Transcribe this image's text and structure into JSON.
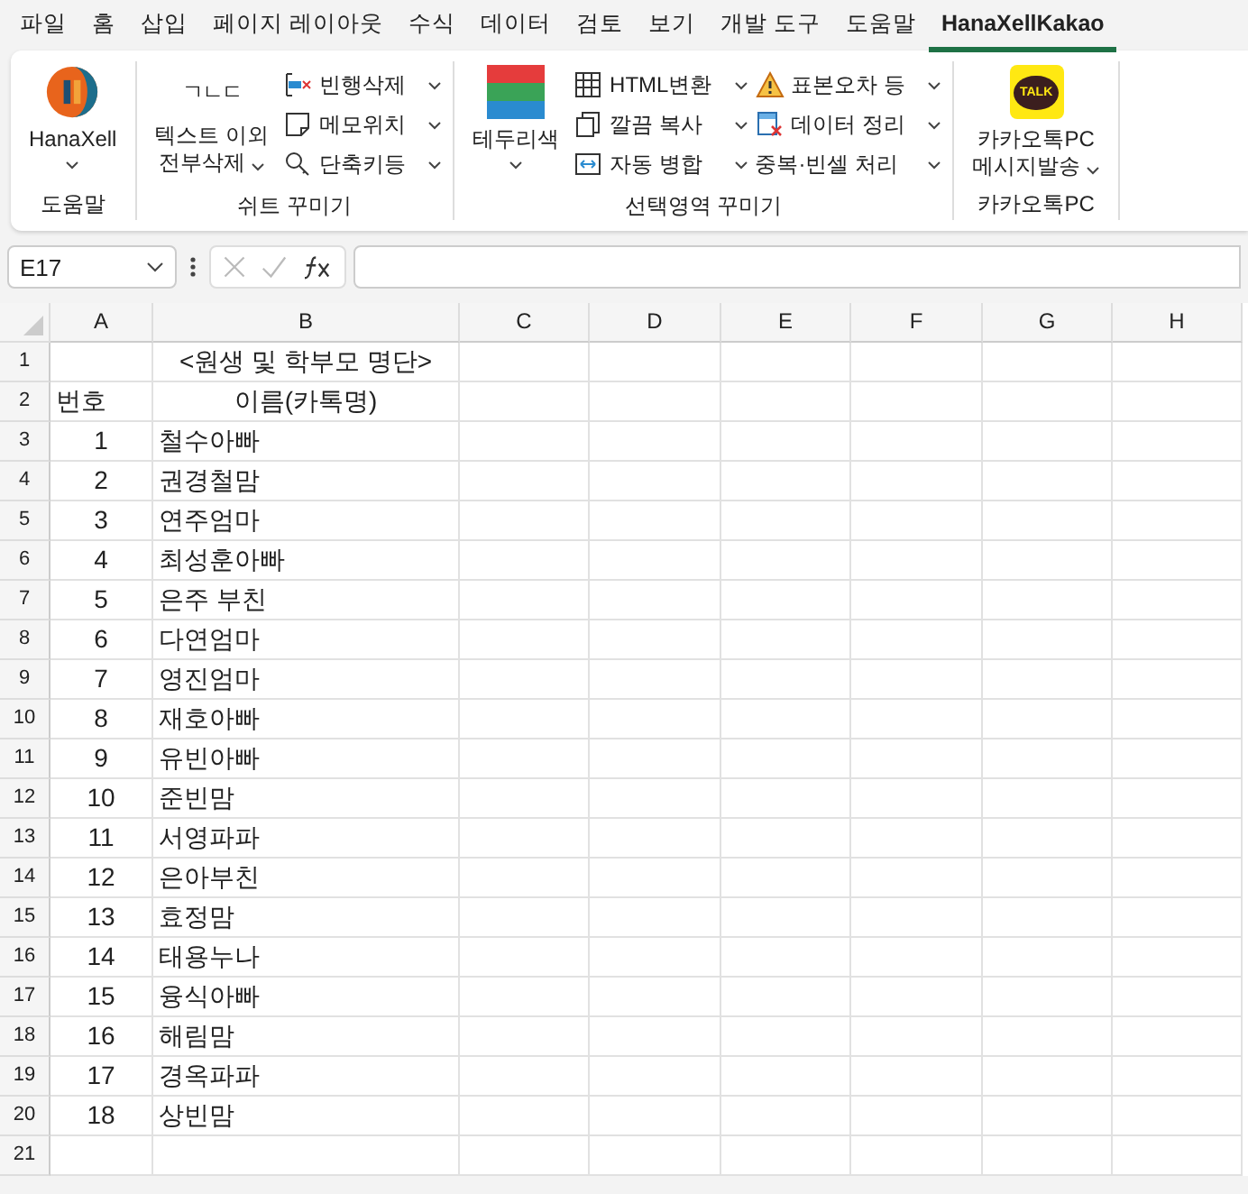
{
  "menu_tabs": [
    {
      "label": "파일",
      "selected": false
    },
    {
      "label": "홈",
      "selected": false
    },
    {
      "label": "삽입",
      "selected": false
    },
    {
      "label": "페이지 레이아웃",
      "selected": false
    },
    {
      "label": "수식",
      "selected": false
    },
    {
      "label": "데이터",
      "selected": false
    },
    {
      "label": "검토",
      "selected": false
    },
    {
      "label": "보기",
      "selected": false
    },
    {
      "label": "개발 도구",
      "selected": false
    },
    {
      "label": "도움말",
      "selected": false
    },
    {
      "label": "HanaXellKakao",
      "selected": true
    }
  ],
  "ribbon": {
    "groups": [
      {
        "label": "도움말",
        "large": {
          "lines": [
            "HanaXell"
          ]
        }
      },
      {
        "label": "쉬트 꾸미기",
        "large": {
          "icon_text": "ㄱㄴㄷ",
          "lines": [
            "텍스트 이외",
            "전부삭제"
          ]
        },
        "columns": [
          [
            "빈행삭제",
            "메모위치",
            "단축키등"
          ]
        ]
      },
      {
        "label": "선택영역 꾸미기",
        "large": {
          "lines": [
            "테두리색"
          ]
        },
        "columns": [
          [
            "HTML변환",
            "깔끔 복사",
            "자동 병합"
          ],
          [
            "표본오차 등",
            "데이터 정리",
            "중복·빈셀 처리"
          ]
        ]
      },
      {
        "label": "카카오톡PC",
        "large": {
          "badge_text": "TALK",
          "lines": [
            "카카오톡PC",
            "메시지발송"
          ]
        }
      }
    ]
  },
  "name_box": "E17",
  "columns": [
    "A",
    "B",
    "C",
    "D",
    "E",
    "F",
    "G",
    "H"
  ],
  "rows": [
    {
      "number": "1",
      "cells": [
        "",
        "<원생 및 학부모 명단>"
      ]
    },
    {
      "number": "2",
      "cells": [
        "번호",
        "이름(카톡명)"
      ]
    },
    {
      "number": "3",
      "cells": [
        "1",
        "철수아빠"
      ]
    },
    {
      "number": "4",
      "cells": [
        "2",
        "권경철맘"
      ]
    },
    {
      "number": "5",
      "cells": [
        "3",
        "연주엄마"
      ]
    },
    {
      "number": "6",
      "cells": [
        "4",
        "최성훈아빠"
      ]
    },
    {
      "number": "7",
      "cells": [
        "5",
        "은주 부친"
      ]
    },
    {
      "number": "8",
      "cells": [
        "6",
        "다연엄마"
      ]
    },
    {
      "number": "9",
      "cells": [
        "7",
        "영진엄마"
      ]
    },
    {
      "number": "10",
      "cells": [
        "8",
        "재호아빠"
      ]
    },
    {
      "number": "11",
      "cells": [
        "9",
        "유빈아빠"
      ]
    },
    {
      "number": "12",
      "cells": [
        "10",
        "준빈맘"
      ]
    },
    {
      "number": "13",
      "cells": [
        "11",
        "서영파파"
      ]
    },
    {
      "number": "14",
      "cells": [
        "12",
        "은아부친"
      ]
    },
    {
      "number": "15",
      "cells": [
        "13",
        "효정맘"
      ]
    },
    {
      "number": "16",
      "cells": [
        "14",
        "태용누나"
      ]
    },
    {
      "number": "17",
      "cells": [
        "15",
        "융식아빠"
      ]
    },
    {
      "number": "18",
      "cells": [
        "16",
        "해림맘"
      ]
    },
    {
      "number": "19",
      "cells": [
        "17",
        "경옥파파"
      ]
    },
    {
      "number": "20",
      "cells": [
        "18",
        "상빈맘"
      ]
    },
    {
      "number": "21",
      "cells": [
        "",
        ""
      ]
    }
  ]
}
